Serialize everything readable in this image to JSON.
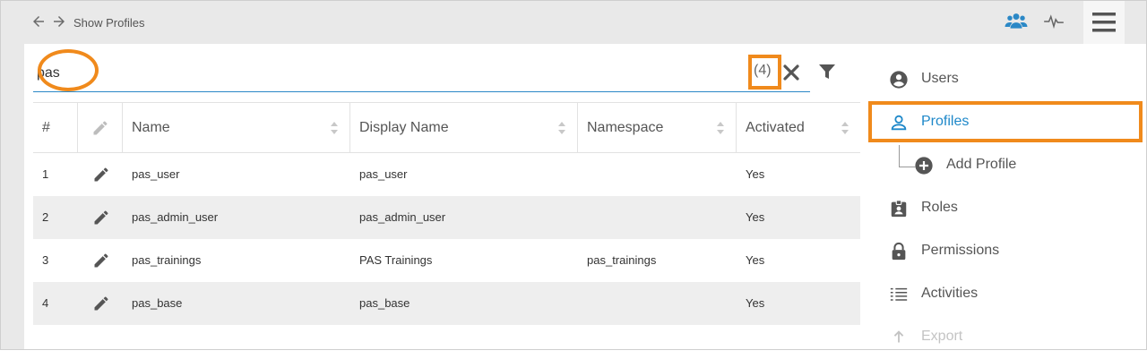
{
  "header": {
    "back_icon": "arrow-left-icon",
    "forward_icon": "arrow-right-icon",
    "breadcrumb": "Show Profiles",
    "users_icon": "users-icon",
    "activity_icon": "activity-icon",
    "menu_icon": "hamburger-menu-icon"
  },
  "search": {
    "value": "pas",
    "result_count": "(4)",
    "clear_icon": "close-icon",
    "filter_icon": "filter-icon"
  },
  "table": {
    "columns": [
      "#",
      "Name",
      "Display Name",
      "Namespace",
      "Activated"
    ],
    "rows": [
      {
        "index": "1",
        "name": "pas_user",
        "display_name": "pas_user",
        "namespace": "",
        "activated": "Yes"
      },
      {
        "index": "2",
        "name": "pas_admin_user",
        "display_name": "pas_admin_user",
        "namespace": "",
        "activated": "Yes"
      },
      {
        "index": "3",
        "name": "pas_trainings",
        "display_name": "PAS Trainings",
        "namespace": "pas_trainings",
        "activated": "Yes"
      },
      {
        "index": "4",
        "name": "pas_base",
        "display_name": "pas_base",
        "namespace": "",
        "activated": "Yes"
      }
    ]
  },
  "side_menu": {
    "items": [
      {
        "label": "Users",
        "icon": "account-circle-icon"
      },
      {
        "label": "Profiles",
        "icon": "person-outline-icon",
        "active": true
      },
      {
        "label": "Add Profile",
        "icon": "add-circle-icon"
      },
      {
        "label": "Roles",
        "icon": "badge-icon"
      },
      {
        "label": "Permissions",
        "icon": "lock-icon"
      },
      {
        "label": "Activities",
        "icon": "list-icon"
      },
      {
        "label": "Export",
        "icon": "export-icon"
      }
    ]
  },
  "colors": {
    "accent": "#1e88c9",
    "highlight": "#f08a1c",
    "row_alt": "#eeeeee"
  }
}
